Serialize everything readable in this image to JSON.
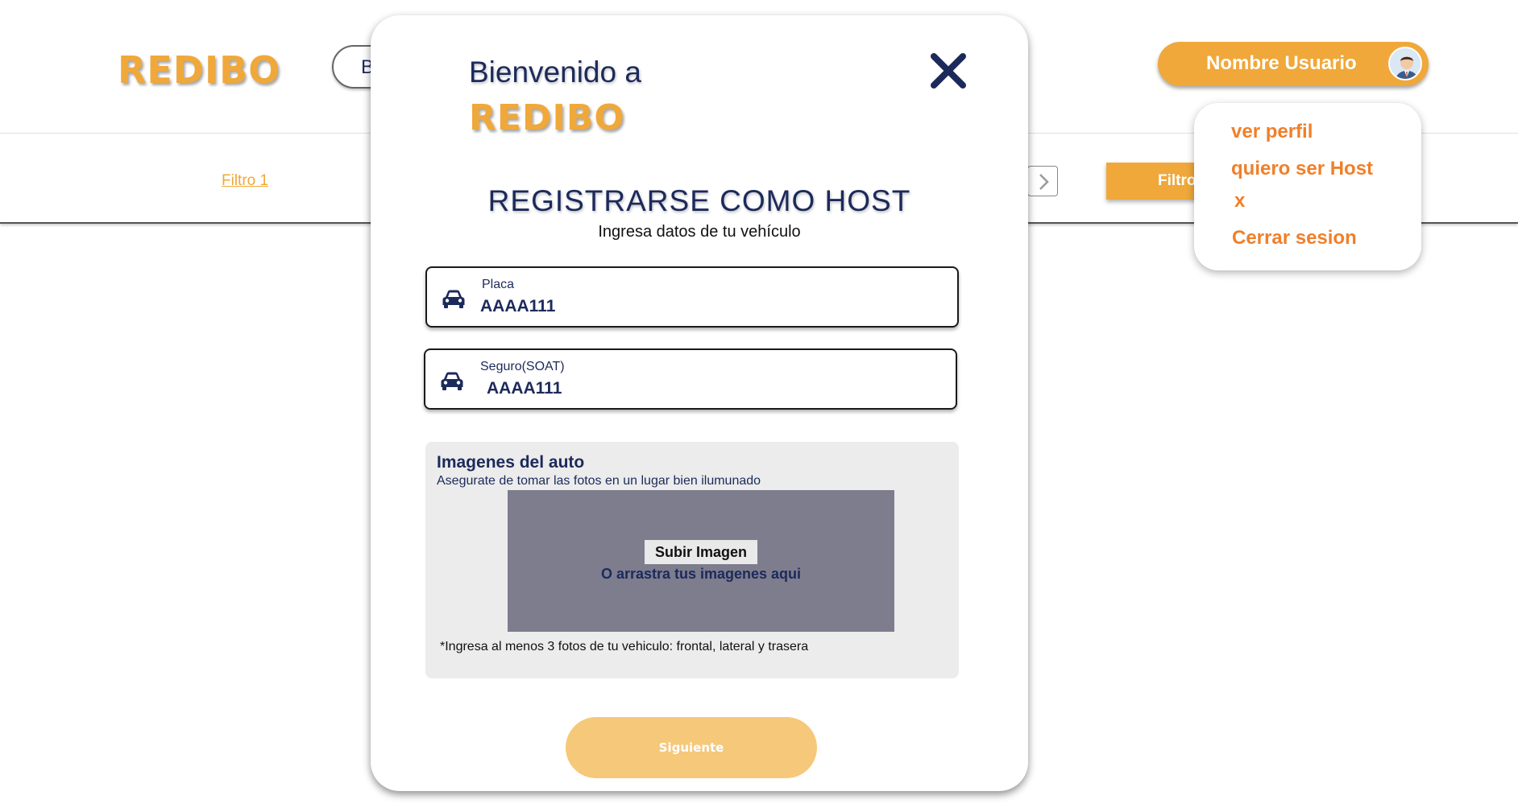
{
  "header": {
    "logo": "REDIBO",
    "search_fragment": "B",
    "user_name": "Nombre Usuario"
  },
  "filters": {
    "filter1": "Filtro 1",
    "filter_button": "Filtro"
  },
  "user_menu": {
    "items": [
      "ver perfil",
      "quiero ser Host",
      "x",
      "Cerrar sesion"
    ]
  },
  "modal": {
    "welcome": "Bienvenido a",
    "logo": "REDIBO",
    "title": "REGISTRARSE COMO HOST",
    "subtitle": "Ingresa datos de tu vehículo",
    "fields": [
      {
        "label": "Placa",
        "value": "AAAA111",
        "icon": "car-icon"
      },
      {
        "label": "Seguro(SOAT)",
        "value": "AAAA111",
        "icon": "car-icon"
      }
    ],
    "images": {
      "title": "Imagenes del auto",
      "subtitle": "Asegurate de tomar las fotos en un lugar bien ilumunado",
      "upload_label": "Subir Imagen",
      "drag_hint": "O arrastra tus imagenes aqui",
      "note": "*Ingresa al menos 3 fotos de tu vehiculo: frontal, lateral y trasera"
    },
    "next_label": "Siguiente"
  },
  "colors": {
    "brand_orange": "#f0a83a",
    "menu_orange": "#f07f2a",
    "navy": "#1c2a5b",
    "next_button": "#f5c87a",
    "dropzone": "#7e7d8e"
  }
}
